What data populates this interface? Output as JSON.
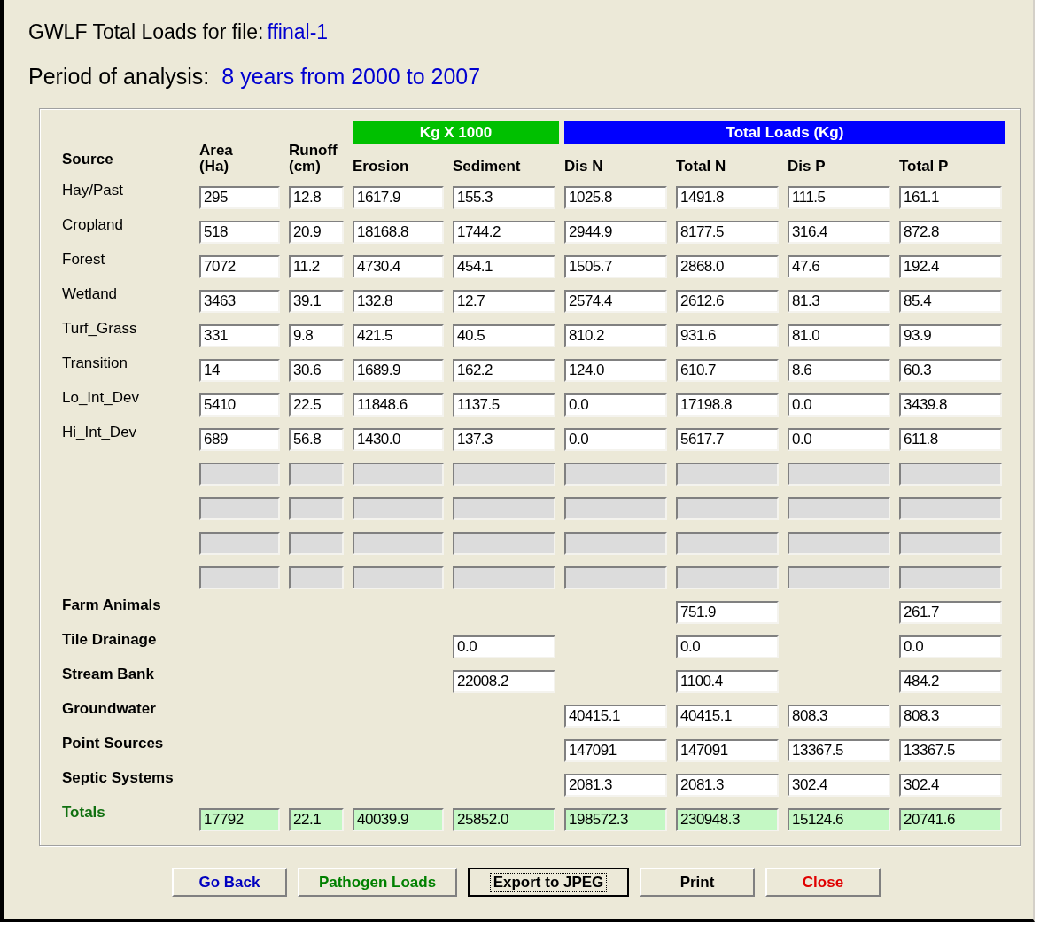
{
  "title": {
    "label": "GWLF Total Loads for file:",
    "file": "ffinal-1"
  },
  "period": {
    "label": "Period of analysis:",
    "value": "8 years from 2000 to 2007"
  },
  "source_header": "Source",
  "columns": [
    {
      "lines": [
        "Area",
        "(Ha)"
      ]
    },
    {
      "lines": [
        "Runoff",
        "(cm)"
      ]
    }
  ],
  "groups": [
    {
      "label": "Kg X 1000",
      "color": "#00c000",
      "columns": [
        {
          "lines": [
            "Erosion"
          ]
        },
        {
          "lines": [
            "Sediment"
          ]
        }
      ]
    },
    {
      "label": "Total Loads (Kg)",
      "color": "#0000ff",
      "columns": [
        {
          "lines": [
            "Dis N"
          ]
        },
        {
          "lines": [
            "Total N"
          ]
        },
        {
          "lines": [
            "Dis P"
          ]
        },
        {
          "lines": [
            "Total P"
          ]
        }
      ]
    }
  ],
  "rows": [
    {
      "kind": "source",
      "label": "Hay/Past",
      "cells": {
        "area": "295",
        "runoff": "12.8",
        "erosion": "1617.9",
        "sediment": "155.3",
        "dis_n": "1025.8",
        "total_n": "1491.8",
        "dis_p": "111.5",
        "total_p": "161.1"
      }
    },
    {
      "kind": "source",
      "label": "Cropland",
      "cells": {
        "area": "518",
        "runoff": "20.9",
        "erosion": "18168.8",
        "sediment": "1744.2",
        "dis_n": "2944.9",
        "total_n": "8177.5",
        "dis_p": "316.4",
        "total_p": "872.8"
      }
    },
    {
      "kind": "source",
      "label": "Forest",
      "cells": {
        "area": "7072",
        "runoff": "11.2",
        "erosion": "4730.4",
        "sediment": "454.1",
        "dis_n": "1505.7",
        "total_n": "2868.0",
        "dis_p": "47.6",
        "total_p": "192.4"
      }
    },
    {
      "kind": "source",
      "label": "Wetland",
      "cells": {
        "area": "3463",
        "runoff": "39.1",
        "erosion": "132.8",
        "sediment": "12.7",
        "dis_n": "2574.4",
        "total_n": "2612.6",
        "dis_p": "81.3",
        "total_p": "85.4"
      }
    },
    {
      "kind": "source",
      "label": "Turf_Grass",
      "cells": {
        "area": "331",
        "runoff": "9.8",
        "erosion": "421.5",
        "sediment": "40.5",
        "dis_n": "810.2",
        "total_n": "931.6",
        "dis_p": "81.0",
        "total_p": "93.9"
      }
    },
    {
      "kind": "source",
      "label": "Transition",
      "cells": {
        "area": "14",
        "runoff": "30.6",
        "erosion": "1689.9",
        "sediment": "162.2",
        "dis_n": "124.0",
        "total_n": "610.7",
        "dis_p": "8.6",
        "total_p": "60.3"
      }
    },
    {
      "kind": "source",
      "label": "Lo_Int_Dev",
      "cells": {
        "area": "5410",
        "runoff": "22.5",
        "erosion": "11848.6",
        "sediment": "1137.5",
        "dis_n": "0.0",
        "total_n": "17198.8",
        "dis_p": "0.0",
        "total_p": "3439.8"
      }
    },
    {
      "kind": "source",
      "label": "Hi_Int_Dev",
      "cells": {
        "area": "689",
        "runoff": "56.8",
        "erosion": "1430.0",
        "sediment": "137.3",
        "dis_n": "0.0",
        "total_n": "5617.7",
        "dis_p": "0.0",
        "total_p": "611.8"
      }
    },
    {
      "kind": "blank"
    },
    {
      "kind": "blank"
    },
    {
      "kind": "blank"
    },
    {
      "kind": "blank"
    },
    {
      "kind": "other",
      "label": "Farm Animals",
      "cells": {
        "total_n": "751.9",
        "total_p": "261.7"
      }
    },
    {
      "kind": "other",
      "label": "Tile Drainage",
      "cells": {
        "sediment": "0.0",
        "total_n": "0.0",
        "total_p": "0.0"
      }
    },
    {
      "kind": "other",
      "label": "Stream Bank",
      "cells": {
        "sediment": "22008.2",
        "total_n": "1100.4",
        "total_p": "484.2"
      }
    },
    {
      "kind": "other",
      "label": "Groundwater",
      "cells": {
        "dis_n": "40415.1",
        "total_n": "40415.1",
        "dis_p": "808.3",
        "total_p": "808.3"
      }
    },
    {
      "kind": "other",
      "label": "Point Sources",
      "cells": {
        "dis_n": "147091",
        "total_n": "147091",
        "dis_p": "13367.5",
        "total_p": "13367.5"
      }
    },
    {
      "kind": "other",
      "label": "Septic Systems",
      "cells": {
        "dis_n": "2081.3",
        "total_n": "2081.3",
        "dis_p": "302.4",
        "total_p": "302.4"
      }
    },
    {
      "kind": "total",
      "label": "Totals",
      "cells": {
        "area": "17792",
        "runoff": "22.1",
        "erosion": "40039.9",
        "sediment": "25852.0",
        "dis_n": "198572.3",
        "total_n": "230948.3",
        "dis_p": "15124.6",
        "total_p": "20741.6"
      }
    }
  ],
  "buttons": [
    {
      "label": "Go Back",
      "color": "#0000c0",
      "focused": false
    },
    {
      "label": "Pathogen Loads",
      "color": "#008000",
      "focused": false
    },
    {
      "label": "Export to JPEG",
      "color": "#000000",
      "focused": true
    },
    {
      "label": "Print",
      "color": "#000000",
      "focused": false
    },
    {
      "label": "Close",
      "color": "#e00000",
      "focused": false
    }
  ]
}
